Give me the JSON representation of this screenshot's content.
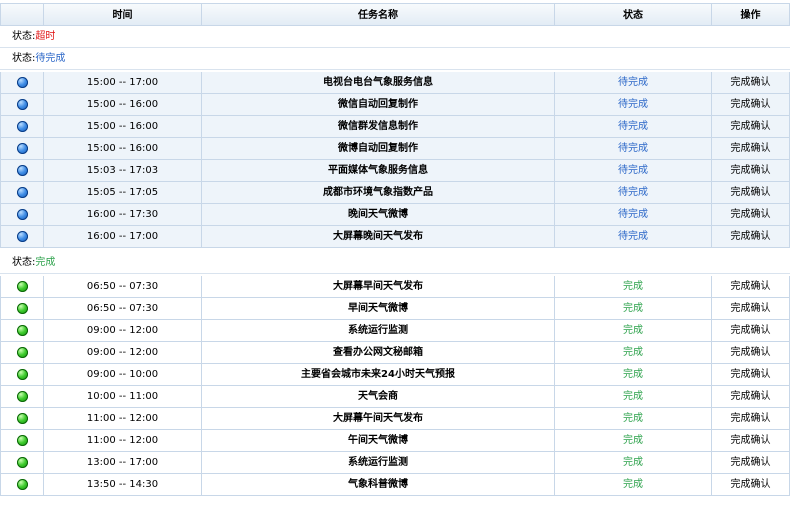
{
  "table": {
    "headers": [
      "",
      "时间",
      "任务名称",
      "状态",
      "操作"
    ]
  },
  "groups": {
    "timeout": {
      "label_prefix": "状态:",
      "label_value": "超时",
      "color": "#e01010"
    },
    "pending": {
      "label_prefix": "状态:",
      "label_value": "待完成",
      "color": "#2b67c8",
      "rows": [
        {
          "time": "15:00 -- 17:00",
          "task": "电视台电台气象服务信息",
          "status": "待完成",
          "action": "完成确认"
        },
        {
          "time": "15:00 -- 16:00",
          "task": "微信自动回复制作",
          "status": "待完成",
          "action": "完成确认"
        },
        {
          "time": "15:00 -- 16:00",
          "task": "微信群发信息制作",
          "status": "待完成",
          "action": "完成确认"
        },
        {
          "time": "15:00 -- 16:00",
          "task": "微博自动回复制作",
          "status": "待完成",
          "action": "完成确认"
        },
        {
          "time": "15:03 -- 17:03",
          "task": "平面媒体气象服务信息",
          "status": "待完成",
          "action": "完成确认"
        },
        {
          "time": "15:05 -- 17:05",
          "task": "成都市环境气象指数产品",
          "status": "待完成",
          "action": "完成确认"
        },
        {
          "time": "16:00 -- 17:30",
          "task": "晚间天气微博",
          "status": "待完成",
          "action": "完成确认"
        },
        {
          "time": "16:00 -- 17:00",
          "task": "大屏幕晚间天气发布",
          "status": "待完成",
          "action": "完成确认"
        }
      ]
    },
    "done": {
      "label_prefix": "状态:",
      "label_value": "完成",
      "color": "#2ca24b",
      "rows": [
        {
          "time": "06:50 -- 07:30",
          "task": "大屏幕早间天气发布",
          "status": "完成",
          "action": "完成确认"
        },
        {
          "time": "06:50 -- 07:30",
          "task": "早间天气微博",
          "status": "完成",
          "action": "完成确认"
        },
        {
          "time": "09:00 -- 12:00",
          "task": "系统运行监测",
          "status": "完成",
          "action": "完成确认"
        },
        {
          "time": "09:00 -- 12:00",
          "task": "查看办公网文秘邮箱",
          "status": "完成",
          "action": "完成确认"
        },
        {
          "time": "09:00 -- 10:00",
          "task": "主要省会城市未来24小时天气预报",
          "status": "完成",
          "action": "完成确认"
        },
        {
          "time": "10:00 -- 11:00",
          "task": "天气会商",
          "status": "完成",
          "action": "完成确认"
        },
        {
          "time": "11:00 -- 12:00",
          "task": "大屏幕午间天气发布",
          "status": "完成",
          "action": "完成确认"
        },
        {
          "time": "11:00 -- 12:00",
          "task": "午间天气微博",
          "status": "完成",
          "action": "完成确认"
        },
        {
          "time": "13:00 -- 17:00",
          "task": "系统运行监测",
          "status": "完成",
          "action": "完成确认"
        },
        {
          "time": "13:50 -- 14:30",
          "task": "气象科普微博",
          "status": "完成",
          "action": "完成确认"
        }
      ]
    }
  },
  "icons": {
    "pending_dot": "blue-circle-icon",
    "done_dot": "green-circle-icon"
  }
}
